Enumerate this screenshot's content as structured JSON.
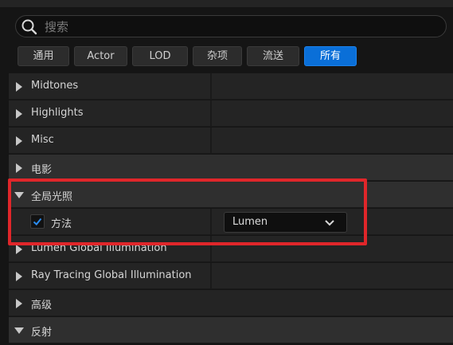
{
  "search": {
    "placeholder": "搜索",
    "value": ""
  },
  "filters": [
    {
      "label": "通用",
      "active": false
    },
    {
      "label": "Actor",
      "active": false
    },
    {
      "label": "LOD",
      "active": false
    },
    {
      "label": "杂项",
      "active": false
    },
    {
      "label": "流送",
      "active": false
    },
    {
      "label": "所有",
      "active": true
    }
  ],
  "rows": [
    {
      "label": "Midtones",
      "kind": "prop",
      "expanded": false
    },
    {
      "label": "Highlights",
      "kind": "prop",
      "expanded": false
    },
    {
      "label": "Misc",
      "kind": "prop",
      "expanded": false
    },
    {
      "label": "电影",
      "kind": "cat",
      "expanded": false
    },
    {
      "label": "全局光照",
      "kind": "cat",
      "expanded": true
    },
    {
      "label": "方法",
      "kind": "checkbox-prop",
      "checked": true,
      "value": "Lumen"
    },
    {
      "label": "Lumen Global Illumination",
      "kind": "prop",
      "expanded": false
    },
    {
      "label": "Ray Tracing Global Illumination",
      "kind": "prop",
      "expanded": false
    },
    {
      "label": "高级",
      "kind": "prop",
      "expanded": false
    },
    {
      "label": "反射",
      "kind": "cat",
      "expanded": true
    }
  ],
  "colors": {
    "accent": "#0a6fd8",
    "highlight": "#e0262a",
    "checkmark": "#2a8cf0"
  }
}
